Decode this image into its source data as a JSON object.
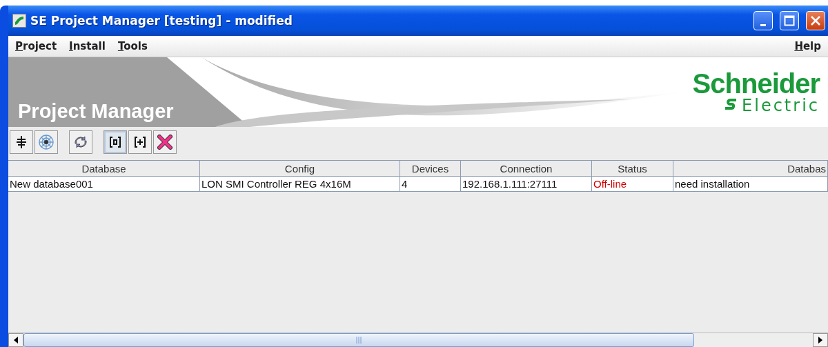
{
  "window": {
    "title": "SE Project Manager [testing] - modified"
  },
  "menu": {
    "left": [
      {
        "label": "Project",
        "underlined": true
      },
      {
        "label": "Install",
        "underlined": true
      },
      {
        "label": "Tools",
        "underlined": true
      }
    ],
    "right": [
      {
        "label": "Help",
        "underlined": true
      }
    ]
  },
  "banner": {
    "title": "Project Manager",
    "logo": {
      "name": "Schneider",
      "sub": "Electric"
    }
  },
  "toolbar": [
    {
      "buttons": [
        {
          "kind": "connect",
          "selected": false
        },
        {
          "kind": "network",
          "selected": false
        }
      ]
    },
    {
      "buttons": [
        {
          "kind": "sync",
          "selected": false
        }
      ]
    },
    {
      "buttons": [
        {
          "kind": "select",
          "selected": true
        },
        {
          "kind": "add",
          "selected": false
        },
        {
          "kind": "delete",
          "selected": false
        }
      ]
    }
  ],
  "table": {
    "columns": [
      "Database",
      "Config",
      "Devices",
      "Connection",
      "Status",
      "Databas"
    ],
    "rows": [
      {
        "cells": [
          "New database001",
          "LON SMI Controller REG 4x16M",
          "4",
          "192.168.1.111:27111",
          "Off-line",
          "need installation"
        ],
        "online": false
      }
    ]
  }
}
